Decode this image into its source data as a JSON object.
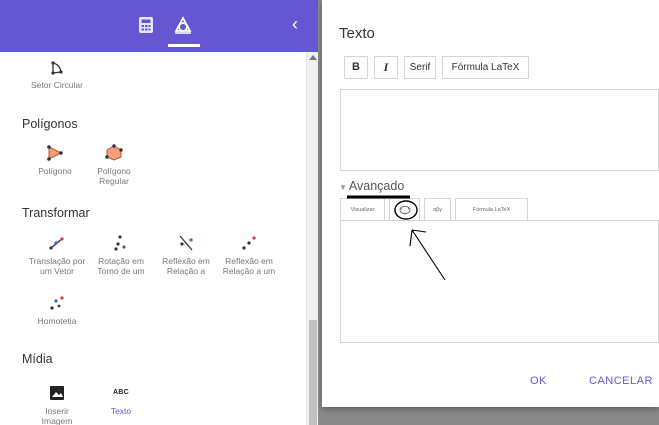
{
  "left_panel": {
    "sections": [
      {
        "title": "",
        "tools": [
          {
            "label": "Setor Circular",
            "icon": "circular-sector-icon"
          }
        ]
      },
      {
        "title": "Polígonos",
        "tools": [
          {
            "label": "Polígono",
            "icon": "polygon-icon"
          },
          {
            "label": "Polígono Regular",
            "icon": "regular-polygon-icon"
          }
        ]
      },
      {
        "title": "Transformar",
        "tools": [
          {
            "label": "Translação por um Vetor",
            "icon": "translate-by-vector-icon"
          },
          {
            "label": "Rotação em Torno de um",
            "icon": "rotate-around-point-icon"
          },
          {
            "label": "Reflexão em Relação a",
            "icon": "reflect-about-line-icon"
          },
          {
            "label": "Reflexão em Relação a um",
            "icon": "reflect-about-point-icon"
          },
          {
            "label": "Homotetia",
            "icon": "dilate-icon"
          }
        ]
      },
      {
        "title": "Mídia",
        "tools": [
          {
            "label": "Inserir Imagem",
            "icon": "image-icon"
          },
          {
            "label": "Texto",
            "icon": "text-icon",
            "glyph": "ABC",
            "active": true
          }
        ]
      }
    ]
  },
  "dialog": {
    "title": "Texto",
    "format_buttons": {
      "bold": "B",
      "italic": "I",
      "serif": "Serif",
      "latex": "Fórmula LaTeX"
    },
    "advanced_label": "Avançado",
    "advanced_tabs": {
      "preview": "Visualizar",
      "geogebra": "",
      "symbols": "αβγ",
      "latex": "Fórmula LaTeX"
    },
    "ok": "OK",
    "cancel": "CANCELAR"
  },
  "colors": {
    "topbar": "#6557d2",
    "accent": "#6557d2",
    "active_label": "#6557d2",
    "tool_label": "#777777",
    "backdrop": "#8a8a8a"
  }
}
